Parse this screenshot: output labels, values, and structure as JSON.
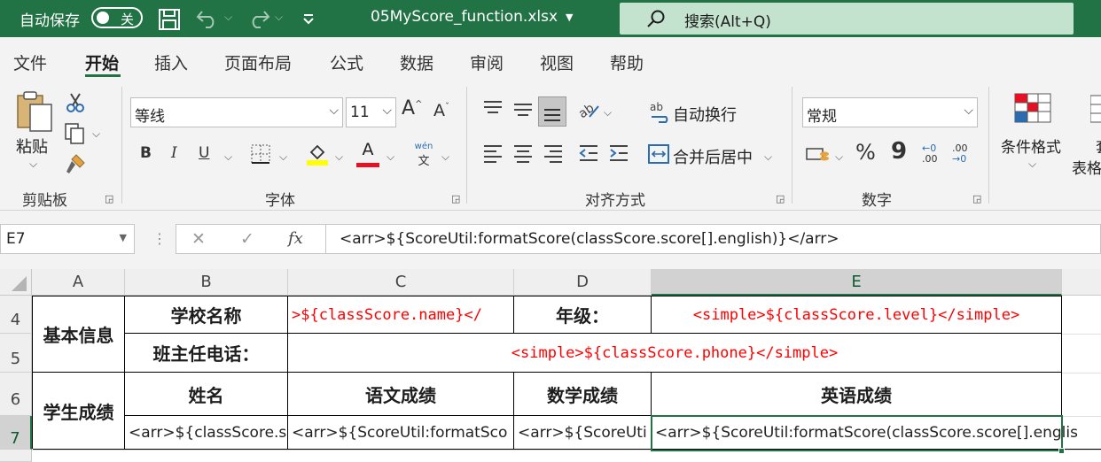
{
  "titlebar": {
    "autosave_label": "自动保存",
    "toggle_state": "关",
    "filename": "05MyScore_function.xlsx",
    "search_placeholder": "搜索(Alt+Q)"
  },
  "tabs": [
    "文件",
    "开始",
    "插入",
    "页面布局",
    "公式",
    "数据",
    "审阅",
    "视图",
    "帮助"
  ],
  "ribbon": {
    "clipboard": {
      "paste": "粘贴",
      "group": "剪贴板"
    },
    "font": {
      "name": "等线",
      "size": "11",
      "grow": "A",
      "shrink": "A",
      "bold": "B",
      "italic": "I",
      "underline": "U",
      "font_color": "A",
      "phonetic_top": "wén",
      "phonetic_bottom": "文",
      "group": "字体"
    },
    "alignment": {
      "wrap": "自动换行",
      "merge": "合并后居中",
      "group": "对齐方式"
    },
    "number": {
      "format": "常规",
      "percent": "%",
      "comma": "9",
      "inc_top": "←0",
      "inc_bottom": ".00",
      "dec_top": ".00",
      "dec_bottom": "→0",
      "group": "数字"
    },
    "styles": {
      "conditional": "条件格式",
      "table_top": "套",
      "table_bottom": "表格"
    }
  },
  "formula_bar": {
    "name_box": "E7",
    "cancel": "✕",
    "enter": "✓",
    "fx": "fx",
    "formula": "<arr>${ScoreUtil:formatScore(classScore.score[].english)}</arr>"
  },
  "columns": [
    "A",
    "B",
    "C",
    "D",
    "E"
  ],
  "rows": [
    "4",
    "5",
    "6",
    "7"
  ],
  "cells": {
    "A4": "基本信息",
    "B4": "学校名称",
    "C4": ">${classScore.name}</",
    "D4": "年级：",
    "E4": "<simple>${classScore.level}</simple>",
    "B5": "班主任电话：",
    "C5": "<simple>${classScore.phone}</simple>",
    "A6": "学生成绩",
    "B6": "姓名",
    "C6": "语文成绩",
    "D6": "数学成绩",
    "E6": "英语成绩",
    "B7": "<arr>${classScore.s",
    "C7": "<arr>${ScoreUtil:formatSco",
    "D7": "<arr>${ScoreUti",
    "E7": "<arr>${ScoreUtil:formatScore(classScore.score[].englis"
  },
  "colors": {
    "accent": "#217346",
    "red_text": "#ff0000"
  }
}
